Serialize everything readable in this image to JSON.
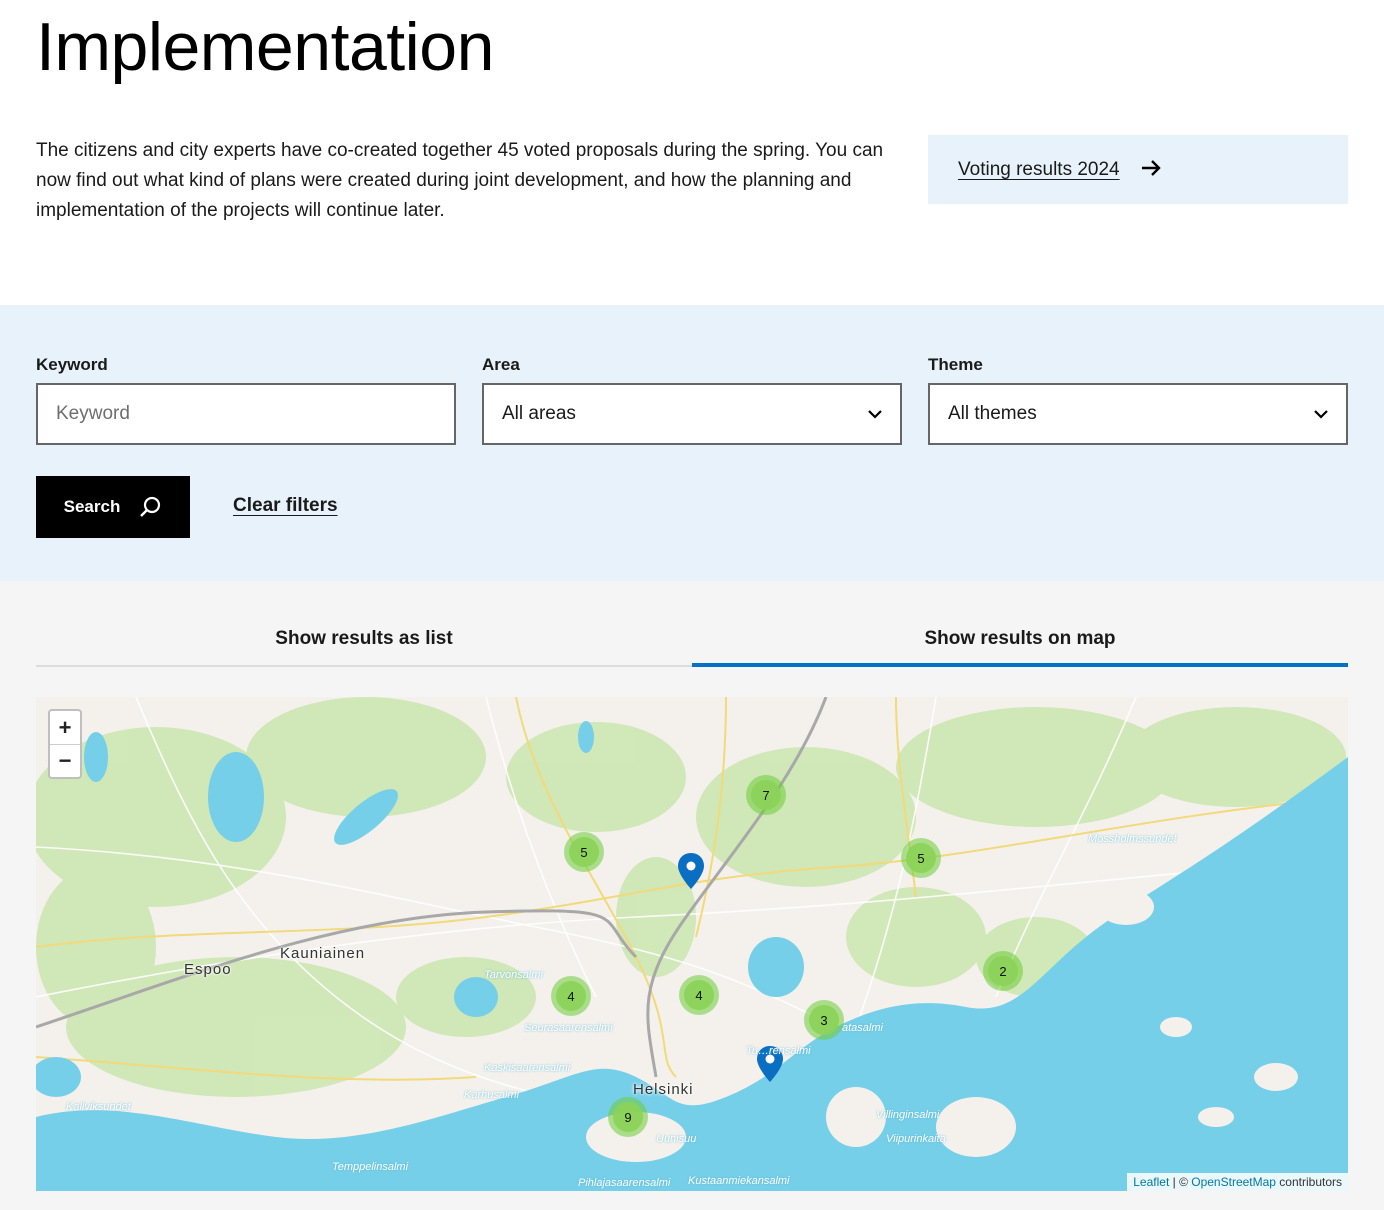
{
  "page": {
    "title": "Implementation",
    "intro": "The citizens and city experts have co-created together 45 voted proposals during the spring. You can now find out what kind of plans were created during joint development, and how the planning and implementation of the projects will continue later.",
    "voting_link": "Voting results 2024"
  },
  "filters": {
    "keyword": {
      "label": "Keyword",
      "placeholder": "Keyword",
      "value": ""
    },
    "area": {
      "label": "Area",
      "value": "All areas"
    },
    "theme": {
      "label": "Theme",
      "value": "All themes"
    },
    "search_label": "Search",
    "clear_label": "Clear filters"
  },
  "tabs": [
    {
      "label": "Show results as list",
      "active": false
    },
    {
      "label": "Show results on map",
      "active": true
    }
  ],
  "map": {
    "zoom_in": "+",
    "zoom_out": "−",
    "clusters": [
      "5",
      "7",
      "5",
      "2",
      "4",
      "4",
      "3",
      "9"
    ],
    "places": [
      "Espoo",
      "Kauniainen",
      "Helsinki"
    ],
    "water_labels": [
      "Tarvonsalmi",
      "Seurasaarensalmi",
      "Kaskisaarensalmi",
      "Karhusalmi",
      "Kallviksundet",
      "Temppelinsalmi",
      "Uunisuu",
      "Pihlajasaarensalmi",
      "Kustaanmiekansalmi",
      "Villinginsalmi",
      "Viipurinkaita",
      "Tu…rensalmi",
      "atasalmi",
      "Mossholmssundet"
    ],
    "attribution_leaflet": "Leaflet",
    "attribution_sep": " | © ",
    "attribution_osm": "OpenStreetMap",
    "attribution_tail": " contributors",
    "colors": {
      "water": "#76cfe8",
      "green": "#cde8b2",
      "land": "#f2efe9",
      "pin": "#0a6fc2",
      "accent": "#0072c6"
    }
  }
}
